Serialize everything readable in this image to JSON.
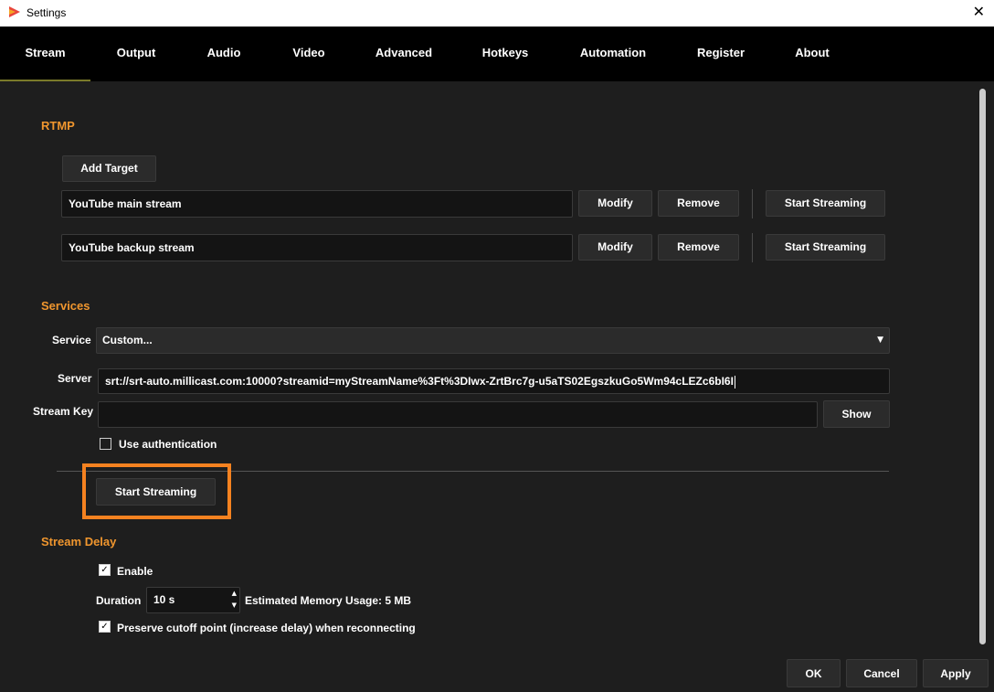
{
  "window": {
    "title": "Settings",
    "close_glyph": "✕"
  },
  "tabs": [
    {
      "label": "Stream"
    },
    {
      "label": "Output"
    },
    {
      "label": "Audio"
    },
    {
      "label": "Video"
    },
    {
      "label": "Advanced"
    },
    {
      "label": "Hotkeys"
    },
    {
      "label": "Automation"
    },
    {
      "label": "Register"
    },
    {
      "label": "About"
    }
  ],
  "rtmp": {
    "title": "RTMP",
    "add_target_label": "Add Target",
    "targets": [
      {
        "name": "YouTube main stream",
        "modify": "Modify",
        "remove": "Remove",
        "start": "Start Streaming"
      },
      {
        "name": "YouTube backup stream",
        "modify": "Modify",
        "remove": "Remove",
        "start": "Start Streaming"
      }
    ]
  },
  "services": {
    "title": "Services",
    "service_label": "Service",
    "service_value": "Custom...",
    "server_label": "Server",
    "server_value": "srt://srt-auto.millicast.com:10000?streamid=myStreamName%3Ft%3DIwx-ZrtBrc7g-u5aTS02EgszkuGo5Wm94cLEZc6bI6I",
    "stream_key_label": "Stream Key",
    "stream_key_value": "",
    "show_label": "Show",
    "use_auth_label": "Use authentication",
    "use_auth_checked": false,
    "start_streaming_label": "Start Streaming"
  },
  "stream_delay": {
    "title": "Stream Delay",
    "enable_label": "Enable",
    "enable_checked": true,
    "duration_label": "Duration",
    "duration_value": "10 s",
    "memory_label": "Estimated Memory Usage: 5 MB",
    "preserve_label": "Preserve cutoff point (increase delay) when reconnecting",
    "preserve_checked": true
  },
  "footer": {
    "ok": "OK",
    "cancel": "Cancel",
    "apply": "Apply"
  },
  "icons": {
    "check": "✓",
    "dropdown": "▼",
    "spin_up": "▲",
    "spin_down": "▼"
  },
  "colors": {
    "accent": "#f0962e",
    "highlight": "#f58220",
    "background": "#1e1e1e",
    "tabbar": "#000000"
  }
}
